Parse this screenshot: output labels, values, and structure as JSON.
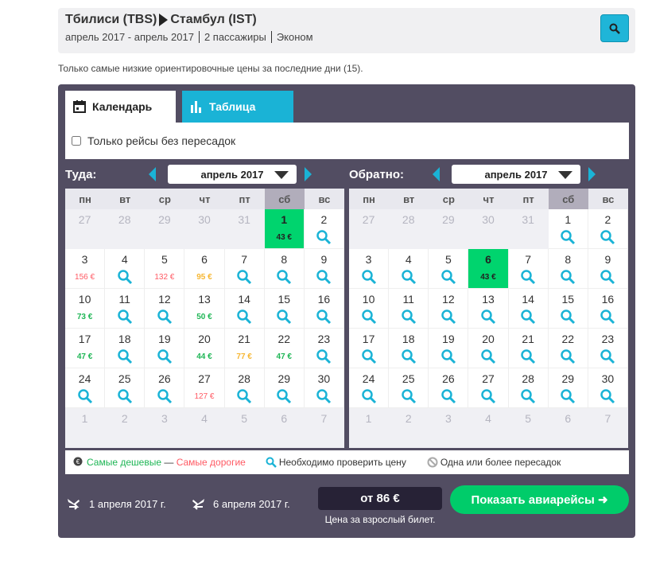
{
  "header": {
    "from": "Тбилиси (TBS)",
    "to": "Стамбул (IST)",
    "dates": "апрель 2017 - апрель 2017",
    "passengers": "2 пассажиры",
    "class": "Эконом"
  },
  "note": "Только самые низкие ориентировочные цены за последние дни (15).",
  "tabs": [
    {
      "label": "Календарь"
    },
    {
      "label": "Таблица"
    }
  ],
  "filter_label": "Только рейсы без пересадок",
  "weekdays": [
    "пн",
    "вт",
    "ср",
    "чт",
    "пт",
    "сб",
    "вс"
  ],
  "outbound": {
    "label": "Туда:",
    "month": "апрель 2017",
    "cells": [
      {
        "d": "27",
        "o": 1
      },
      {
        "d": "28",
        "o": 1
      },
      {
        "d": "29",
        "o": 1
      },
      {
        "d": "30",
        "o": 1
      },
      {
        "d": "31",
        "o": 1
      },
      {
        "d": "1",
        "p": "43 €",
        "c": "dark",
        "best": 1
      },
      {
        "d": "2",
        "s": 1
      },
      {
        "d": "3",
        "p": "156 €",
        "c": "red"
      },
      {
        "d": "4",
        "s": 1
      },
      {
        "d": "5",
        "p": "132 €",
        "c": "red"
      },
      {
        "d": "6",
        "p": "95 €",
        "c": "orange"
      },
      {
        "d": "7",
        "s": 1
      },
      {
        "d": "8",
        "s": 1
      },
      {
        "d": "9",
        "s": 1
      },
      {
        "d": "10",
        "p": "73 €",
        "c": "green"
      },
      {
        "d": "11",
        "s": 1
      },
      {
        "d": "12",
        "s": 1
      },
      {
        "d": "13",
        "p": "50 €",
        "c": "green"
      },
      {
        "d": "14",
        "s": 1
      },
      {
        "d": "15",
        "s": 1
      },
      {
        "d": "16",
        "s": 1
      },
      {
        "d": "17",
        "p": "47 €",
        "c": "green"
      },
      {
        "d": "18",
        "s": 1
      },
      {
        "d": "19",
        "s": 1
      },
      {
        "d": "20",
        "p": "44 €",
        "c": "green"
      },
      {
        "d": "21",
        "p": "77 €",
        "c": "orange"
      },
      {
        "d": "22",
        "p": "47 €",
        "c": "green"
      },
      {
        "d": "23",
        "s": 1
      },
      {
        "d": "24",
        "s": 1
      },
      {
        "d": "25",
        "s": 1
      },
      {
        "d": "26",
        "s": 1
      },
      {
        "d": "27",
        "p": "127 €",
        "c": "red"
      },
      {
        "d": "28",
        "s": 1
      },
      {
        "d": "29",
        "s": 1
      },
      {
        "d": "30",
        "s": 1
      },
      {
        "d": "1",
        "o": 1
      },
      {
        "d": "2",
        "o": 1
      },
      {
        "d": "3",
        "o": 1
      },
      {
        "d": "4",
        "o": 1
      },
      {
        "d": "5",
        "o": 1
      },
      {
        "d": "6",
        "o": 1
      },
      {
        "d": "7",
        "o": 1
      }
    ]
  },
  "return": {
    "label": "Обратно:",
    "month": "апрель 2017",
    "cells": [
      {
        "d": "27",
        "o": 1
      },
      {
        "d": "28",
        "o": 1
      },
      {
        "d": "29",
        "o": 1
      },
      {
        "d": "30",
        "o": 1
      },
      {
        "d": "31",
        "o": 1
      },
      {
        "d": "1",
        "s": 1
      },
      {
        "d": "2",
        "s": 1
      },
      {
        "d": "3",
        "s": 1
      },
      {
        "d": "4",
        "s": 1
      },
      {
        "d": "5",
        "s": 1
      },
      {
        "d": "6",
        "p": "43 €",
        "c": "dark",
        "best": 1
      },
      {
        "d": "7",
        "s": 1
      },
      {
        "d": "8",
        "s": 1
      },
      {
        "d": "9",
        "s": 1
      },
      {
        "d": "10",
        "s": 1
      },
      {
        "d": "11",
        "s": 1
      },
      {
        "d": "12",
        "s": 1
      },
      {
        "d": "13",
        "s": 1
      },
      {
        "d": "14",
        "s": 1
      },
      {
        "d": "15",
        "s": 1
      },
      {
        "d": "16",
        "s": 1
      },
      {
        "d": "17",
        "s": 1
      },
      {
        "d": "18",
        "s": 1
      },
      {
        "d": "19",
        "s": 1
      },
      {
        "d": "20",
        "s": 1
      },
      {
        "d": "21",
        "s": 1
      },
      {
        "d": "22",
        "s": 1
      },
      {
        "d": "23",
        "s": 1
      },
      {
        "d": "24",
        "s": 1
      },
      {
        "d": "25",
        "s": 1
      },
      {
        "d": "26",
        "s": 1
      },
      {
        "d": "27",
        "s": 1
      },
      {
        "d": "28",
        "s": 1
      },
      {
        "d": "29",
        "s": 1
      },
      {
        "d": "30",
        "s": 1
      },
      {
        "d": "1",
        "o": 1
      },
      {
        "d": "2",
        "o": 1
      },
      {
        "d": "3",
        "o": 1
      },
      {
        "d": "4",
        "o": 1
      },
      {
        "d": "5",
        "o": 1
      },
      {
        "d": "6",
        "o": 1
      },
      {
        "d": "7",
        "o": 1
      }
    ]
  },
  "legend": {
    "cheap": "Самые дешевые",
    "dash": " — ",
    "expensive": "Самые дорогие",
    "check": "Необходимо проверить цену",
    "stops": "Одна или более пересадок"
  },
  "summary": {
    "depart": "1 апреля 2017 г.",
    "return": "6 апреля 2017 г.",
    "price": "от 86 €",
    "price_note": "Цена за взрослый билет.",
    "cta": "Показать авиарейсы ➜"
  },
  "colors": {
    "accent": "#1ab3d6",
    "best": "#00d46e",
    "cta": "#00cc6a",
    "panel": "#524d62"
  }
}
